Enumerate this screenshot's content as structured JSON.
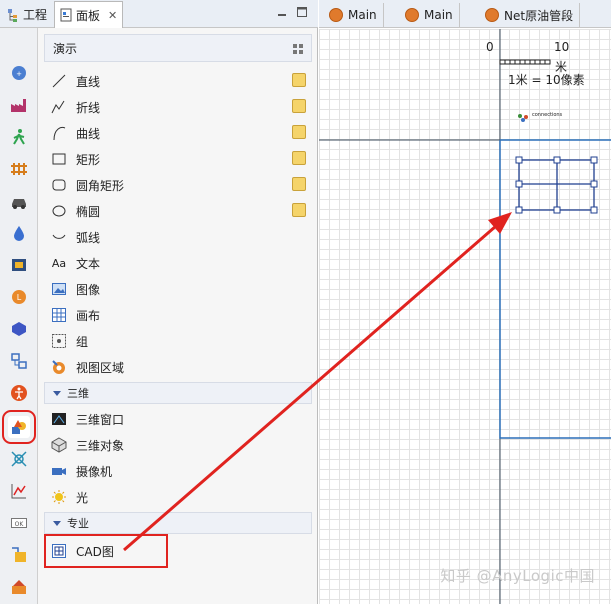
{
  "view_tabs": {
    "project_label": "工程",
    "palette_label": "面板",
    "close_label": "✕"
  },
  "editor_tabs": [
    {
      "label": "Main"
    },
    {
      "label": "Main"
    },
    {
      "label": "Net原油管段"
    }
  ],
  "palette": {
    "section_title": "演示",
    "items": [
      {
        "label": "直线",
        "icon": "line-icon"
      },
      {
        "label": "折线",
        "icon": "polyline-icon"
      },
      {
        "label": "曲线",
        "icon": "curve-icon"
      },
      {
        "label": "矩形",
        "icon": "rectangle-icon"
      },
      {
        "label": "圆角矩形",
        "icon": "rounded-rectangle-icon"
      },
      {
        "label": "椭圆",
        "icon": "oval-icon"
      },
      {
        "label": "弧线",
        "icon": "arc-icon"
      },
      {
        "label": "文本",
        "icon": "text-icon"
      },
      {
        "label": "图像",
        "icon": "image-icon"
      },
      {
        "label": "画布",
        "icon": "canvas-icon"
      },
      {
        "label": "组",
        "icon": "group-icon"
      },
      {
        "label": "视图区域",
        "icon": "view-area-icon"
      }
    ],
    "section_3d": "三维",
    "items_3d": [
      {
        "label": "三维窗口",
        "icon": "3d-window-icon"
      },
      {
        "label": "三维对象",
        "icon": "3d-object-icon"
      },
      {
        "label": "摄像机",
        "icon": "camera-icon"
      },
      {
        "label": "光",
        "icon": "light-icon"
      }
    ],
    "section_pro": "专业",
    "items_pro": [
      {
        "label": "CAD图",
        "icon": "cad-icon"
      }
    ]
  },
  "canvas": {
    "scale_zero": "0",
    "scale_ten": "10",
    "scale_unit": "米",
    "scale_ratio": "1米 = 10像素",
    "connections_label": "connections",
    "watermark": "知乎 @AnyLogic中国"
  },
  "colors": {
    "highlight": "#e0231f",
    "frame_blue": "#2b6fb8",
    "selection_blue": "#1f3f8f"
  }
}
